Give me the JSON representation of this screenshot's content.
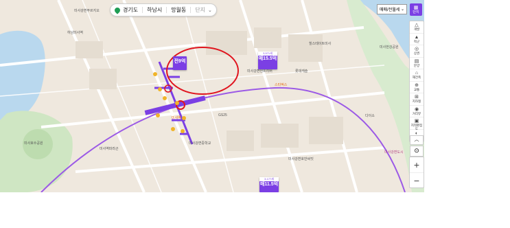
{
  "breadcrumb": {
    "region": "경기도",
    "city": "하남시",
    "district": "망월동",
    "more": "단지"
  },
  "filter_select": "매매/전월세",
  "top_button": "단지",
  "sidebar": [
    "개발",
    "학군",
    "상권",
    "분양",
    "재건축",
    "교통",
    "지하철",
    "거리뷰",
    "지적편집도",
    "위성"
  ],
  "zoom": {
    "in": "+",
    "out": "−"
  },
  "markers": [
    {
      "header": "",
      "value": "전9억",
      "sub": ""
    },
    {
      "header": "3,571세",
      "value": "매15.5억",
      "sub": ""
    },
    {
      "header": "3,177세",
      "value": "매11.5억",
      "sub": ""
    }
  ],
  "pois": [
    {
      "label": "미사강변푸르지오",
      "cls": ""
    },
    {
      "label": "미사역",
      "cls": "o"
    },
    {
      "label": "미사역파라곤",
      "cls": ""
    },
    {
      "label": "하남미사역",
      "cls": ""
    },
    {
      "label": "GS25",
      "cls": ""
    },
    {
      "label": "미사강변센트리버",
      "cls": ""
    },
    {
      "label": "미사강변호반써밋",
      "cls": ""
    },
    {
      "label": "스타벅스",
      "cls": "o"
    },
    {
      "label": "미사강변중학교",
      "cls": ""
    },
    {
      "label": "미사한강공원",
      "cls": ""
    },
    {
      "label": "힐스테이트미사",
      "cls": ""
    },
    {
      "label": "미사호수공원",
      "cls": ""
    },
    {
      "label": "롯데캐슬",
      "cls": ""
    },
    {
      "label": "다이소",
      "cls": ""
    },
    {
      "label": "미사강변도시",
      "cls": "p"
    }
  ],
  "colors": {
    "accent": "#7b3fe4",
    "subway_line": "#9b59e6",
    "annotation": "#e0141e",
    "river": "#b9d8ee",
    "park": "#cfe6c3"
  }
}
